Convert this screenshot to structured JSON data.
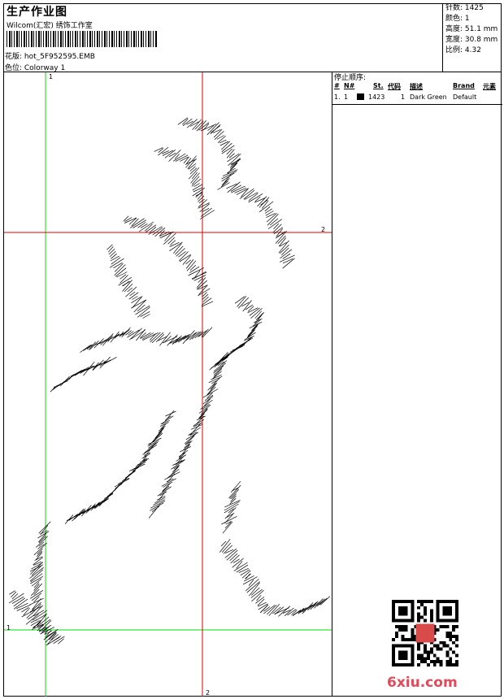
{
  "header": {
    "title": "生产作业图",
    "company": "Wilcom(汇宏) 绣饰工作室",
    "design_name": "花版: hot_5F952595.EMB",
    "colorway": "色位: Colorway 1"
  },
  "stats": {
    "stitches": "针数: 1425",
    "colors": "颜色: 1",
    "height": "高度: 51.1 mm",
    "width": "宽度: 30.8 mm",
    "scale": "比例: 4.32"
  },
  "stop_sequence": {
    "title": "停止顺序:",
    "columns": [
      "#",
      "N#",
      "St.",
      "代码",
      "描述",
      "Brand",
      "元素"
    ],
    "rows": [
      {
        "index": "1.",
        "needle": "1",
        "stitches": "1423",
        "code": "1",
        "description": "Dark Green",
        "brand": "Default",
        "element": ""
      }
    ]
  },
  "guides": {
    "markers": [
      "1",
      "2",
      "2",
      "1"
    ]
  },
  "watermark": "6xiu.com",
  "colors": {
    "vertical_guide_green": "#00dd00",
    "horizontal_guide_red": "#dd0000",
    "thread": "#000000",
    "watermark": "#e24a5a"
  }
}
